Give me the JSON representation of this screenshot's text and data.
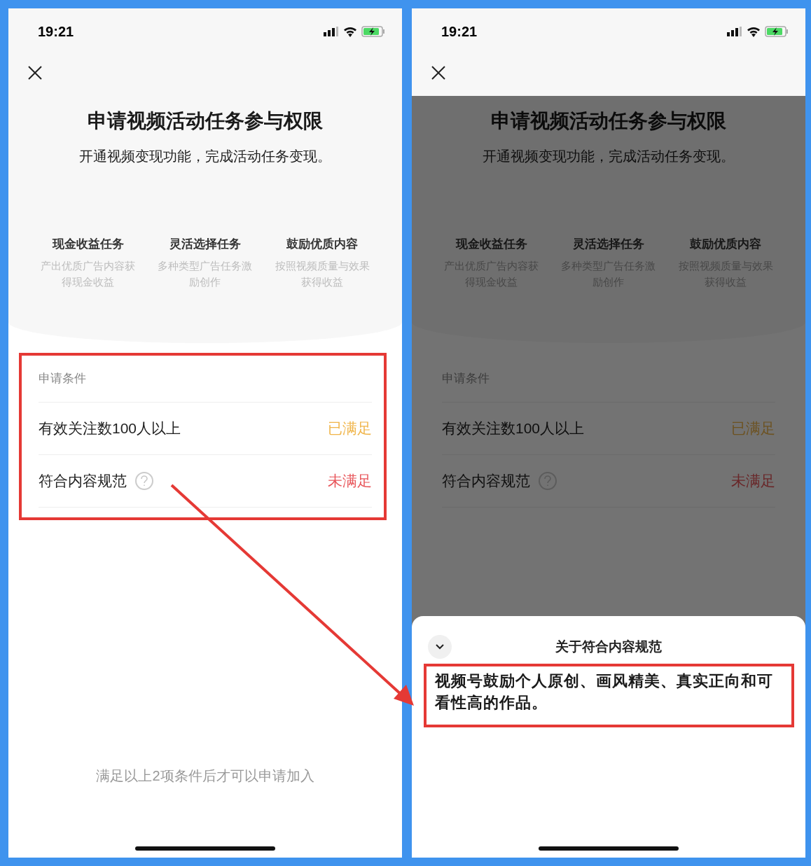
{
  "screens": [
    {
      "status_bar": {
        "time": "19:21"
      },
      "title": "申请视频活动任务参与权限",
      "subtitle": "开通视频变现功能，完成活动任务变现。",
      "features": [
        {
          "title": "现金收益任务",
          "description": "产出优质广告内容获得现金收益"
        },
        {
          "title": "灵活选择任务",
          "description": "多种类型广告任务激励创作"
        },
        {
          "title": "鼓励优质内容",
          "description": "按照视频质量与效果获得收益"
        }
      ],
      "conditions": {
        "heading": "申请条件",
        "items": [
          {
            "label": "有效关注数100人以上",
            "status": "已满足",
            "met": true,
            "has_help": false
          },
          {
            "label": "符合内容规范",
            "status": "未满足",
            "met": false,
            "has_help": true
          }
        ]
      },
      "footer_note": "满足以上2项条件后才可以申请加入",
      "dimmed": false
    },
    {
      "status_bar": {
        "time": "19:21"
      },
      "title": "申请视频活动任务参与权限",
      "subtitle": "开通视频变现功能，完成活动任务变现。",
      "features": [
        {
          "title": "现金收益任务",
          "description": "产出优质广告内容获得现金收益"
        },
        {
          "title": "灵活选择任务",
          "description": "多种类型广告任务激励创作"
        },
        {
          "title": "鼓励优质内容",
          "description": "按照视频质量与效果获得收益"
        }
      ],
      "conditions": {
        "heading": "申请条件",
        "items": [
          {
            "label": "有效关注数100人以上",
            "status": "已满足",
            "met": true,
            "has_help": false
          },
          {
            "label": "符合内容规范",
            "status": "未满足",
            "met": false,
            "has_help": true
          }
        ]
      },
      "dimmed": true,
      "sheet": {
        "title": "关于符合内容规范",
        "body": "视频号鼓励个人原创、画风精美、真实正向和可看性高的作品。"
      }
    }
  ]
}
